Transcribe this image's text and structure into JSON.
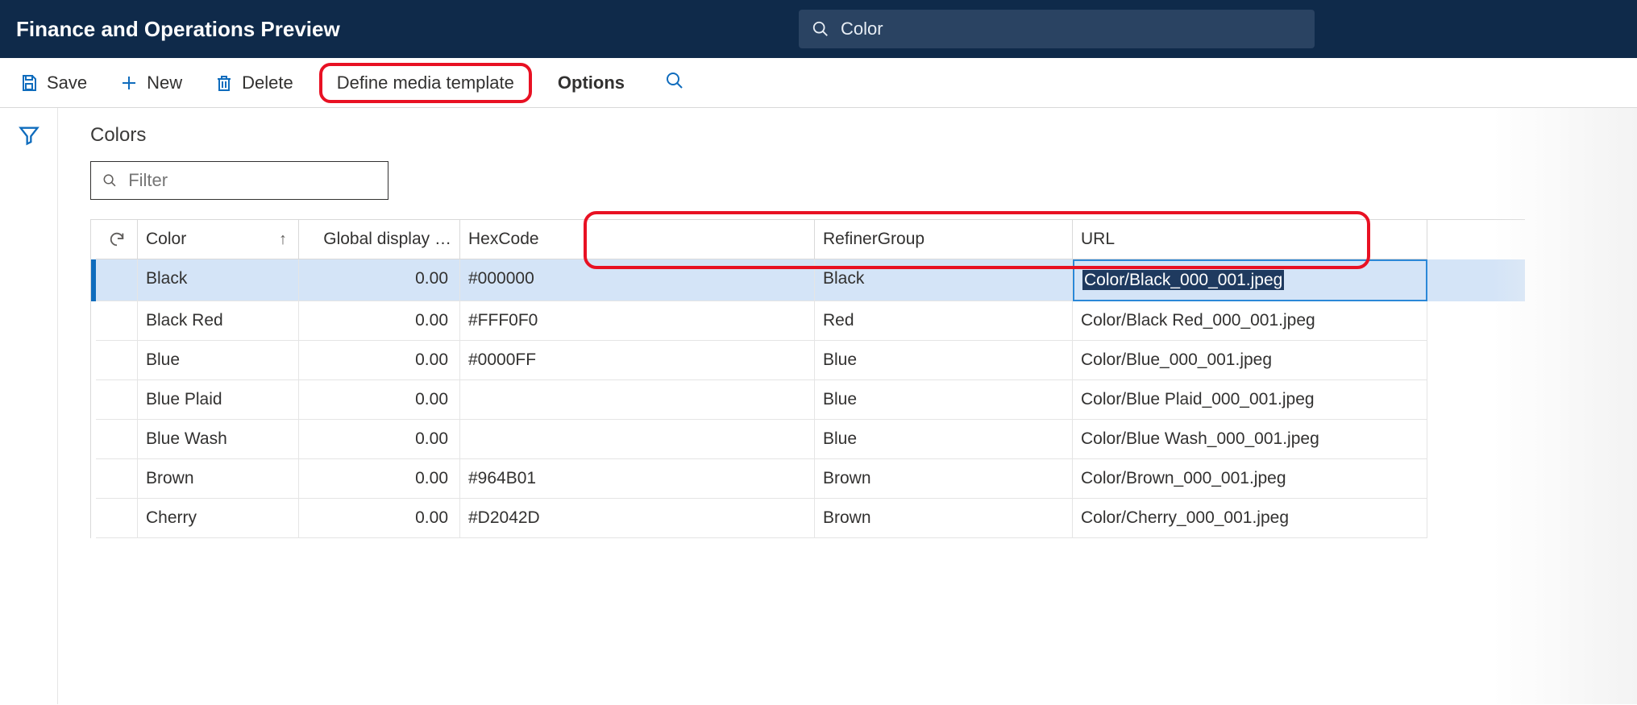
{
  "app_title": "Finance and Operations Preview",
  "search_value": "Color",
  "actions": {
    "save": "Save",
    "new": "New",
    "delete": "Delete",
    "define_media_template": "Define media template",
    "options": "Options"
  },
  "page_title": "Colors",
  "filter_placeholder": "Filter",
  "columns": {
    "color": "Color",
    "global_display": "Global display …",
    "hexcode": "HexCode",
    "refiner_group": "RefinerGroup",
    "url": "URL"
  },
  "rows": [
    {
      "color": "Black",
      "display": "0.00",
      "hex": "#000000",
      "refiner": "Black",
      "url": "Color/Black_000_001.jpeg",
      "selected": true
    },
    {
      "color": "Black Red",
      "display": "0.00",
      "hex": "#FFF0F0",
      "refiner": "Red",
      "url": "Color/Black Red_000_001.jpeg",
      "selected": false
    },
    {
      "color": "Blue",
      "display": "0.00",
      "hex": "#0000FF",
      "refiner": "Blue",
      "url": "Color/Blue_000_001.jpeg",
      "selected": false
    },
    {
      "color": "Blue Plaid",
      "display": "0.00",
      "hex": "",
      "refiner": "Blue",
      "url": "Color/Blue Plaid_000_001.jpeg",
      "selected": false
    },
    {
      "color": "Blue Wash",
      "display": "0.00",
      "hex": "",
      "refiner": "Blue",
      "url": "Color/Blue Wash_000_001.jpeg",
      "selected": false
    },
    {
      "color": "Brown",
      "display": "0.00",
      "hex": "#964B01",
      "refiner": "Brown",
      "url": "Color/Brown_000_001.jpeg",
      "selected": false
    },
    {
      "color": "Cherry",
      "display": "0.00",
      "hex": "#D2042D",
      "refiner": "Brown",
      "url": "Color/Cherry_000_001.jpeg",
      "selected": false
    }
  ]
}
